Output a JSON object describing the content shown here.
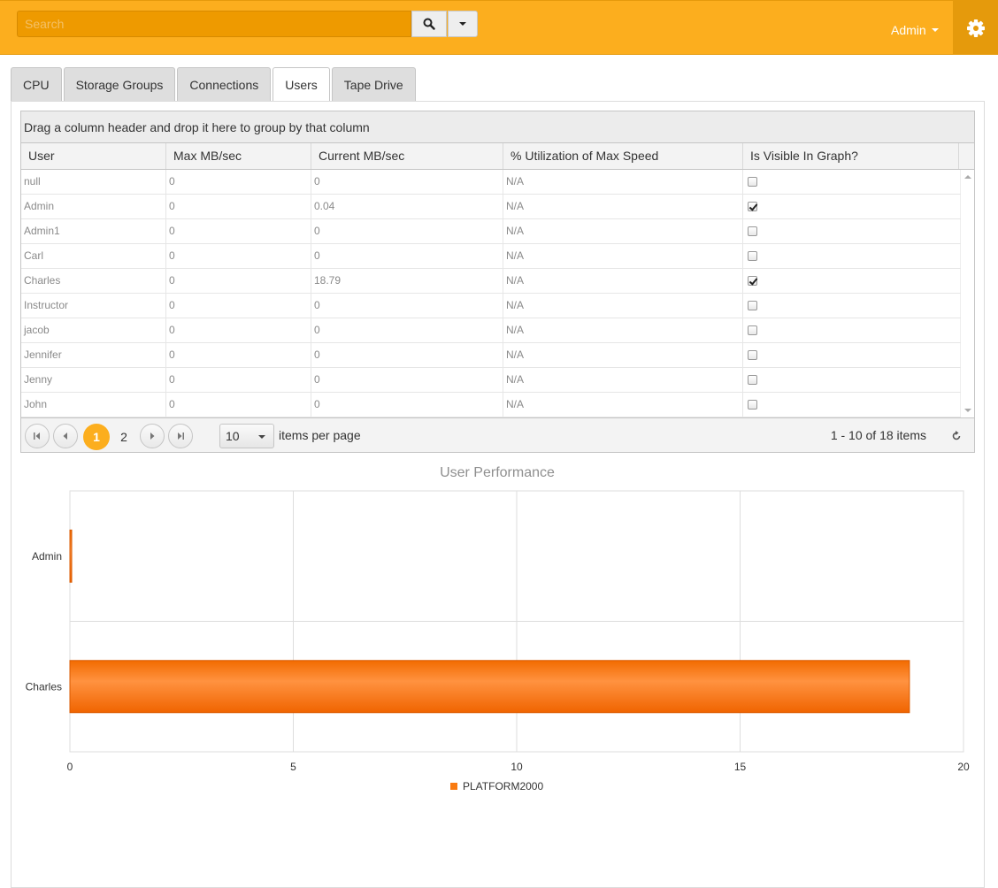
{
  "header": {
    "search_placeholder": "Search",
    "user_label": "Admin",
    "accent": "#fcae1e"
  },
  "tabs": [
    {
      "label": "CPU"
    },
    {
      "label": "Storage Groups"
    },
    {
      "label": "Connections"
    },
    {
      "label": "Users",
      "active": true
    },
    {
      "label": "Tape Drive"
    }
  ],
  "grid": {
    "group_hint": "Drag a column header and drop it here to group by that column",
    "columns": [
      "User",
      "Max MB/sec",
      "Current MB/sec",
      "% Utilization of Max Speed",
      "Is Visible In Graph?"
    ],
    "rows": [
      {
        "user": "null",
        "max": "0",
        "current": "0",
        "util": "N/A",
        "visible": false
      },
      {
        "user": "Admin",
        "max": "0",
        "current": "0.04",
        "util": "N/A",
        "visible": true
      },
      {
        "user": "Admin1",
        "max": "0",
        "current": "0",
        "util": "N/A",
        "visible": false
      },
      {
        "user": "Carl",
        "max": "0",
        "current": "0",
        "util": "N/A",
        "visible": false
      },
      {
        "user": "Charles",
        "max": "0",
        "current": "18.79",
        "util": "N/A",
        "visible": true
      },
      {
        "user": "Instructor",
        "max": "0",
        "current": "0",
        "util": "N/A",
        "visible": false
      },
      {
        "user": "jacob",
        "max": "0",
        "current": "0",
        "util": "N/A",
        "visible": false
      },
      {
        "user": "Jennifer",
        "max": "0",
        "current": "0",
        "util": "N/A",
        "visible": false
      },
      {
        "user": "Jenny",
        "max": "0",
        "current": "0",
        "util": "N/A",
        "visible": false
      },
      {
        "user": "John",
        "max": "0",
        "current": "0",
        "util": "N/A",
        "visible": false
      }
    ],
    "pager": {
      "pages": [
        "1",
        "2"
      ],
      "current_page": "1",
      "page_size": "10",
      "page_size_label": "items per page",
      "info": "1 - 10 of 18 items"
    }
  },
  "chart_data": {
    "type": "bar",
    "orientation": "horizontal",
    "title": "User Performance",
    "categories": [
      "Admin",
      "Charles"
    ],
    "series": [
      {
        "name": "PLATFORM2000",
        "values": [
          0.04,
          18.79
        ],
        "color": "#f97a10"
      }
    ],
    "xlim": [
      0,
      20
    ],
    "xticks": [
      0,
      5,
      10,
      15,
      20
    ],
    "grid": true,
    "legend": "bottom"
  }
}
